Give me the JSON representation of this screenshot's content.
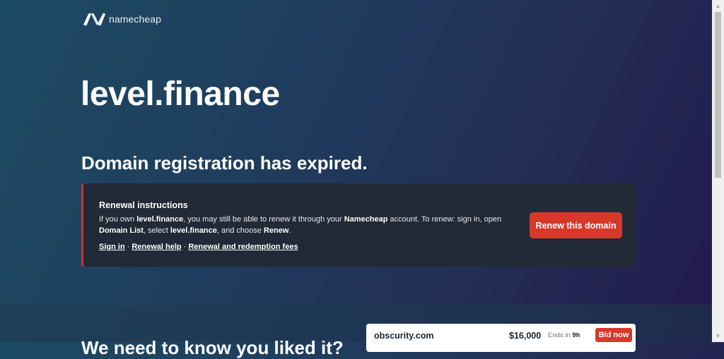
{
  "brand": {
    "name": "namecheap"
  },
  "domain": "level.finance",
  "expired_heading": "Domain registration has expired.",
  "renewal": {
    "title": "Renewal instructions",
    "body": {
      "t1": "If you own ",
      "domain": "level.finance",
      "t2": ", you may still be able to renew it through your ",
      "brand": "Namecheap",
      "t3": " account. To renew: sign in, open ",
      "domain_list": "Domain List",
      "t4": ", select ",
      "domain2": "level.finance",
      "t5": ", and choose ",
      "renew": "Renew",
      "t6": "."
    },
    "links": {
      "sign_in": "Sign in",
      "renewal_help": "Renewal help",
      "fees": "Renewal and redemption fees",
      "separator": "·"
    },
    "button": "Renew this domain"
  },
  "lower_heading": "We need to know you liked it?",
  "auction": {
    "name": "obscurity.com",
    "price": "$16,000",
    "ends_label": "Ends in",
    "ends_value": "9h",
    "bid_label": "Bid now"
  },
  "colors": {
    "accent": "#d6382a",
    "card": "#212a36"
  }
}
